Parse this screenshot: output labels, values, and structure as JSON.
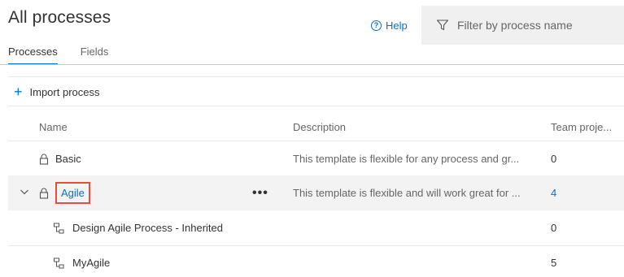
{
  "header": {
    "title": "All processes",
    "help_label": "Help"
  },
  "filter": {
    "placeholder": "Filter by process name"
  },
  "tabs": [
    {
      "label": "Processes",
      "active": true
    },
    {
      "label": "Fields",
      "active": false
    }
  ],
  "toolbar": {
    "import_label": "Import process"
  },
  "table": {
    "columns": [
      "Name",
      "Description",
      "Team proje..."
    ],
    "rows": [
      {
        "name": "Basic",
        "description": "This template is flexible for any process and gr...",
        "count": "0",
        "locked": true,
        "expandable": false
      },
      {
        "name": "Agile",
        "description": "This template is flexible and will work great for ...",
        "count": "4",
        "locked": true,
        "expandable": true,
        "expanded": true,
        "selected": true,
        "more": "•••"
      },
      {
        "name": "Design Agile Process - Inherited",
        "description": "",
        "count": "0",
        "inherited": true
      },
      {
        "name": "MyAgile",
        "description": "",
        "count": "5",
        "inherited": true
      }
    ]
  },
  "colors": {
    "accent": "#0078d4",
    "link": "#106ebe",
    "highlight": "#e74c3c"
  },
  "icons": [
    "help-icon",
    "filter-icon",
    "plus-icon",
    "lock-icon",
    "chevron-down-icon",
    "more-icon",
    "inherited-process-icon"
  ]
}
